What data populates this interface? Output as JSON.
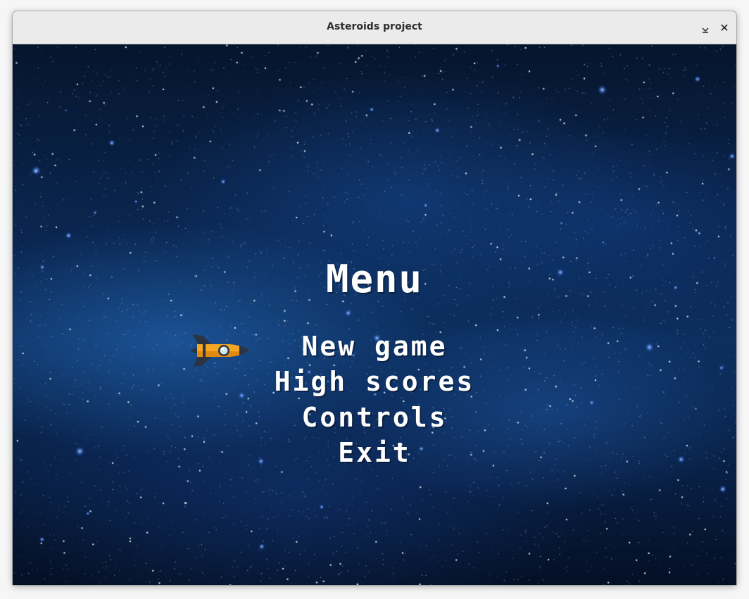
{
  "window": {
    "title": "Asteroids project",
    "minimize_icon": "chevron-down-icon",
    "close_icon": "close-icon",
    "close_glyph": "✕"
  },
  "menu": {
    "title": "Menu",
    "items": [
      {
        "label": "New game"
      },
      {
        "label": "High scores"
      },
      {
        "label": "Controls"
      },
      {
        "label": "Exit"
      }
    ],
    "selected_index": 0,
    "cursor_icon": "rocket-icon"
  },
  "colors": {
    "text": "#ffffff",
    "rocket_body": "#f5a623",
    "rocket_dark": "#2b3440",
    "space_dark": "#06152d",
    "space_glow": "#2a6ec0"
  }
}
